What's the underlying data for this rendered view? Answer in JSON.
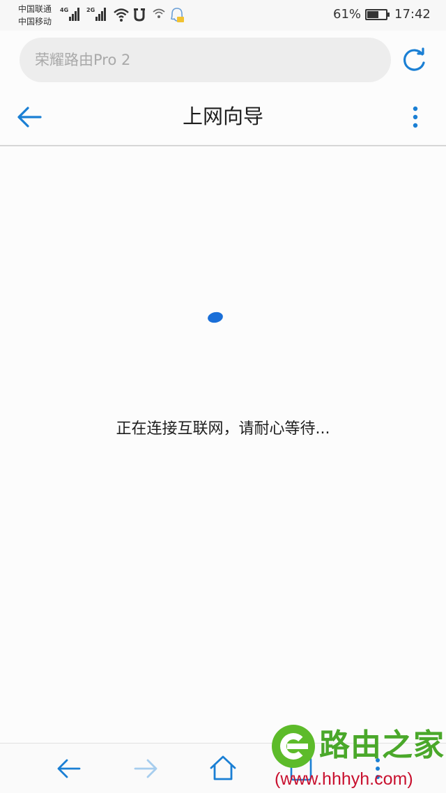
{
  "status_bar": {
    "carrier_1": "中国联通",
    "carrier_2": "中国移动",
    "network_1": "4G",
    "network_2": "2G",
    "battery_percent": "61%",
    "battery_level": 0.61,
    "time": "17:42"
  },
  "address_bar": {
    "text": "荣耀路由Pro 2"
  },
  "nav": {
    "title": "上网向导"
  },
  "content": {
    "message": "正在连接互联网，请耐心等待..."
  },
  "watermark": {
    "name": "路由之家",
    "url": "(www.hhhyh.com)"
  },
  "colors": {
    "accent": "#1a7fd4",
    "spinner": "#1a6fd8",
    "watermark_green": "#5dbb2a",
    "watermark_red": "#c8102e"
  }
}
